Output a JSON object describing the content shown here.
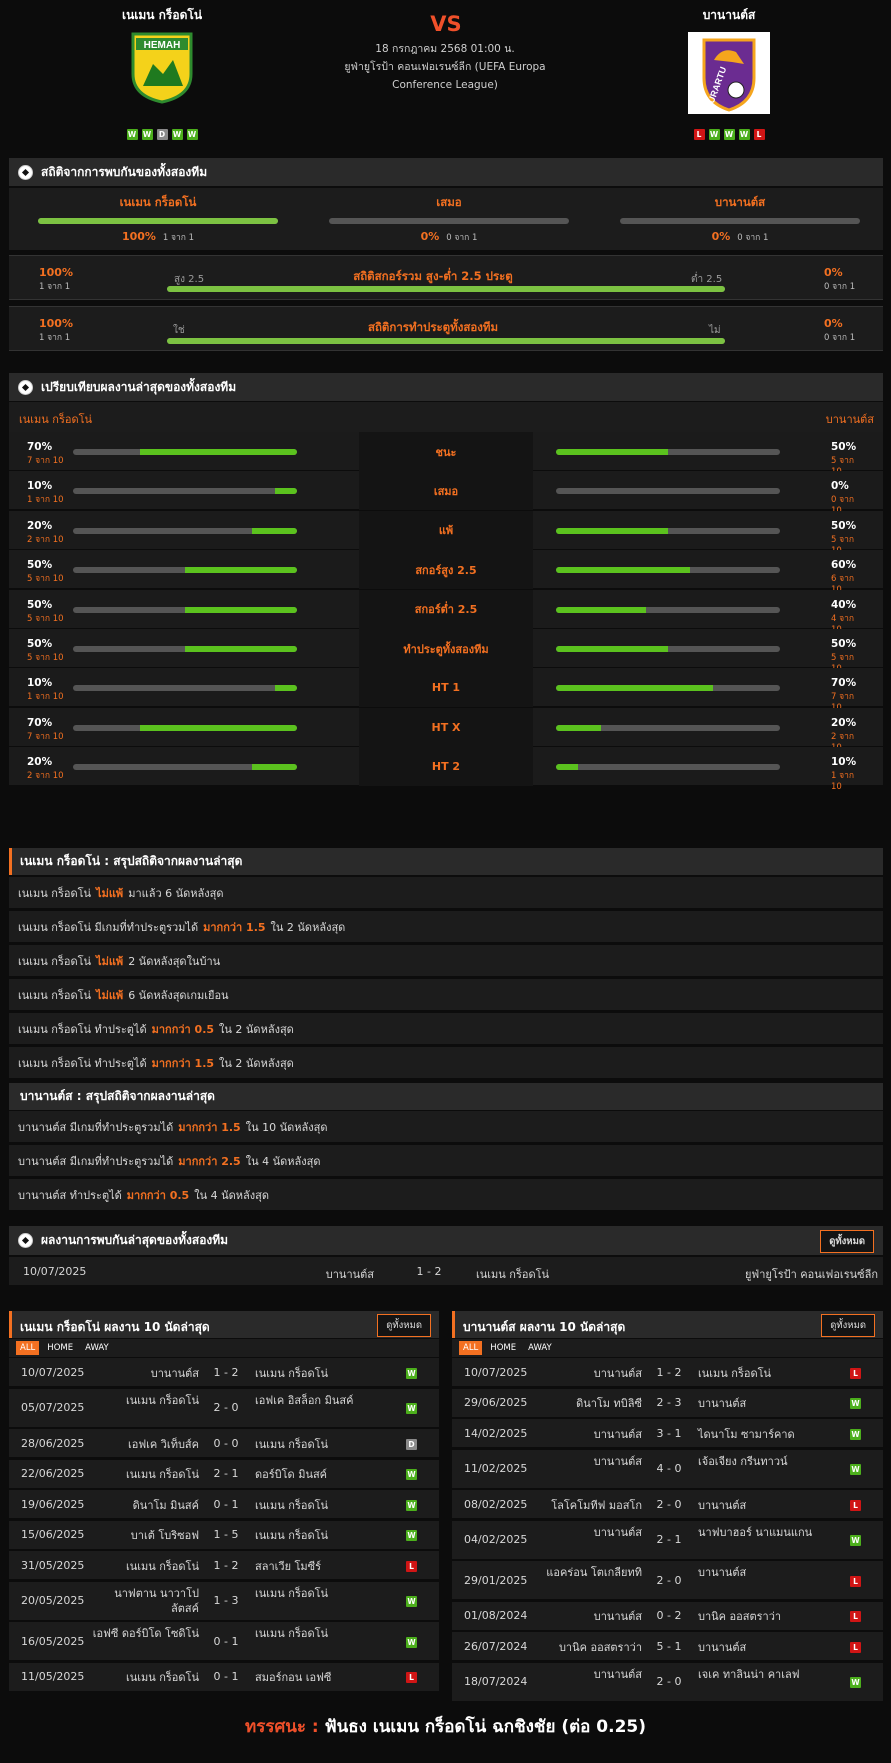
{
  "header": {
    "home_name": "เนเมน กร็อดโน่",
    "away_name": "บานานต์ส",
    "vs": "VS",
    "match_date": "18 กรกฎาคม 2568 01:00 น.",
    "competition_line1": "ยูฟ่ายูโรป้า คอนเฟอเรนซ์ลีก (UEFA Europa",
    "competition_line2": "Conference League)",
    "home_form": [
      "W",
      "W",
      "D",
      "W",
      "W"
    ],
    "away_form": [
      "L",
      "W",
      "W",
      "W",
      "L"
    ],
    "home_logo_text": "НЕМАН",
    "away_logo_text": "URARTU"
  },
  "h2h_stats": {
    "title": "สถิติจากการพบกันของทั้งสองทีม",
    "home": {
      "label": "เนเมน กร็อดโน่",
      "pct": "100%",
      "count": "1 จาก 1",
      "value": 1.0
    },
    "draw": {
      "label": "เสมอ",
      "pct": "0%",
      "count": "0 จาก 1",
      "value": 0
    },
    "away": {
      "label": "บานานต์ส",
      "pct": "0%",
      "count": "0 จาก 1",
      "value": 0
    },
    "over_under": {
      "left_pct": "100%",
      "left_count": "1 จาก 1",
      "left_label": "สูง 2.5",
      "title": "สถิติสกอร์รวม สูง-ต่ำ 2.5 ประตู",
      "right_label": "ต่ำ 2.5",
      "right_pct": "0%",
      "right_count": "0 จาก 1",
      "value": 1.0
    },
    "btts": {
      "left_pct": "100%",
      "left_count": "1 จาก 1",
      "left_label": "ใช่",
      "title": "สถิติการทำประตูทั้งสองทีม",
      "right_label": "ไม่",
      "right_pct": "0%",
      "right_count": "0 จาก 1",
      "value": 1.0
    }
  },
  "compare": {
    "title": "เปรียบเทียบผลงานล่าสุดของทั้งสองทีม",
    "home_label": "เนเมน กร็อดโน่",
    "away_label": "บานานต์ส",
    "rows": [
      {
        "label": "ชนะ",
        "lp": "70%",
        "lc": "7 จาก 10",
        "lv": 0.7,
        "rp": "50%",
        "rc": "5 จาก 10",
        "rv": 0.5
      },
      {
        "label": "เสมอ",
        "lp": "10%",
        "lc": "1 จาก 10",
        "lv": 0.1,
        "rp": "0%",
        "rc": "0 จาก 10",
        "rv": 0
      },
      {
        "label": "แพ้",
        "lp": "20%",
        "lc": "2 จาก 10",
        "lv": 0.2,
        "rp": "50%",
        "rc": "5 จาก 10",
        "rv": 0.5
      },
      {
        "label": "สกอร์สูง 2.5",
        "lp": "50%",
        "lc": "5 จาก 10",
        "lv": 0.5,
        "rp": "60%",
        "rc": "6 จาก 10",
        "rv": 0.6
      },
      {
        "label": "สกอร์ต่ำ 2.5",
        "lp": "50%",
        "lc": "5 จาก 10",
        "lv": 0.5,
        "rp": "40%",
        "rc": "4 จาก 10",
        "rv": 0.4
      },
      {
        "label": "ทำประตูทั้งสองทีม",
        "lp": "50%",
        "lc": "5 จาก 10",
        "lv": 0.5,
        "rp": "50%",
        "rc": "5 จาก 10",
        "rv": 0.5
      },
      {
        "label": "HT 1",
        "lp": "10%",
        "lc": "1 จาก 10",
        "lv": 0.1,
        "rp": "70%",
        "rc": "7 จาก 10",
        "rv": 0.7
      },
      {
        "label": "HT X",
        "lp": "70%",
        "lc": "7 จาก 10",
        "lv": 0.7,
        "rp": "20%",
        "rc": "2 จาก 10",
        "rv": 0.2
      },
      {
        "label": "HT 2",
        "lp": "20%",
        "lc": "2 จาก 10",
        "lv": 0.2,
        "rp": "10%",
        "rc": "1 จาก 10",
        "rv": 0.1
      }
    ]
  },
  "home_summary": {
    "title": "เนเมน กร็อดโน่ : สรุปสถิติจากผลงานล่าสุด",
    "rows": [
      {
        "pre": "เนเมน กร็อดโน่",
        "hl": "ไม่แพ้",
        "post": "มาแล้ว 6 นัดหลังสุด"
      },
      {
        "pre": "เนเมน กร็อดโน่ มีเกมที่ทำประตูรวมได้",
        "hl": "มากกว่า 1.5",
        "post": "ใน 2 นัดหลังสุด"
      },
      {
        "pre": "เนเมน กร็อดโน่",
        "hl": "ไม่แพ้",
        "post": "2 นัดหลังสุดในบ้าน"
      },
      {
        "pre": "เนเมน กร็อดโน่",
        "hl": "ไม่แพ้",
        "post": "6 นัดหลังสุดเกมเยือน"
      },
      {
        "pre": "เนเมน กร็อดโน่ ทำประตูได้",
        "hl": "มากกว่า 0.5",
        "post": "ใน 2 นัดหลังสุด"
      },
      {
        "pre": "เนเมน กร็อดโน่ ทำประตูได้",
        "hl": "มากกว่า 1.5",
        "post": "ใน 2 นัดหลังสุด"
      }
    ]
  },
  "away_summary": {
    "title": "บานานต์ส : สรุปสถิติจากผลงานล่าสุด",
    "rows": [
      {
        "pre": "บานานต์ส มีเกมที่ทำประตูรวมได้",
        "hl": "มากกว่า 1.5",
        "post": "ใน 10 นัดหลังสุด"
      },
      {
        "pre": "บานานต์ส มีเกมที่ทำประตูรวมได้",
        "hl": "มากกว่า 2.5",
        "post": "ใน 4 นัดหลังสุด"
      },
      {
        "pre": "บานานต์ส ทำประตูได้",
        "hl": "มากกว่า 0.5",
        "post": "ใน 4 นัดหลังสุด"
      }
    ]
  },
  "h2h_results": {
    "title": "ผลงานการพบกันล่าสุดของทั้งสองทีม",
    "view_all": "ดูทั้งหมด",
    "rows": [
      {
        "date": "10/07/2025",
        "home": "บานานต์ส",
        "score": "1 - 2",
        "away": "เนเมน กร็อดโน่",
        "comp": "ยูฟ่ายูโรป้า คอนเฟอเรนซ์ลีก"
      }
    ]
  },
  "home_last10": {
    "title": "เนเมน กร็อดโน่ ผลงาน 10 นัดล่าสุด",
    "view_all": "ดูทั้งหมด",
    "tabs": [
      "ALL",
      "HOME",
      "AWAY"
    ],
    "rows": [
      {
        "date": "10/07/2025",
        "home": "บานานต์ส",
        "score": "1 - 2",
        "away": "เนเมน กร็อดโน่",
        "res": "W"
      },
      {
        "date": "05/07/2025",
        "home": "เนเมน กร็อดโน่",
        "score": "2 - 0",
        "away": "เอฟเค อิสล็อก มินสค์",
        "res": "W"
      },
      {
        "date": "28/06/2025",
        "home": "เอฟเค วิเท็บส์ค",
        "score": "0 - 0",
        "away": "เนเมน กร็อดโน่",
        "res": "D"
      },
      {
        "date": "22/06/2025",
        "home": "เนเมน กร็อดโน่",
        "score": "2 - 1",
        "away": "ดอร์บิโด มินสค์",
        "res": "W"
      },
      {
        "date": "19/06/2025",
        "home": "ดินาโม มินสค์",
        "score": "0 - 1",
        "away": "เนเมน กร็อดโน่",
        "res": "W"
      },
      {
        "date": "15/06/2025",
        "home": "บาเต้ โบริซอฟ",
        "score": "1 - 5",
        "away": "เนเมน กร็อดโน่",
        "res": "W"
      },
      {
        "date": "31/05/2025",
        "home": "เนเมน กร็อดโน่",
        "score": "1 - 2",
        "away": "สลาเวีย โมซีร์",
        "res": "L"
      },
      {
        "date": "20/05/2025",
        "home": "นาฟตาน นาวาโปลัตสค์",
        "score": "1 - 3",
        "away": "เนเมน กร็อดโน่",
        "res": "W"
      },
      {
        "date": "16/05/2025",
        "home": "เอฟซี ดอร์บิโด โซดิโน่",
        "score": "0 - 1",
        "away": "เนเมน กร็อดโน่",
        "res": "W"
      },
      {
        "date": "11/05/2025",
        "home": "เนเมน กร็อดโน่",
        "score": "0 - 1",
        "away": "สมอร์กอน เอฟซี",
        "res": "L"
      }
    ]
  },
  "away_last10": {
    "title": "บานานต์ส ผลงาน 10 นัดล่าสุด",
    "view_all": "ดูทั้งหมด",
    "tabs": [
      "ALL",
      "HOME",
      "AWAY"
    ],
    "rows": [
      {
        "date": "10/07/2025",
        "home": "บานานต์ส",
        "score": "1 - 2",
        "away": "เนเมน กร็อดโน่",
        "res": "L"
      },
      {
        "date": "29/06/2025",
        "home": "ดินาโม ทบิลิซี",
        "score": "2 - 3",
        "away": "บานานต์ส",
        "res": "W"
      },
      {
        "date": "14/02/2025",
        "home": "บานานต์ส",
        "score": "3 - 1",
        "away": "ไดนาโม ซามาร์คาด",
        "res": "W"
      },
      {
        "date": "11/02/2025",
        "home": "บานานต์ส",
        "score": "4 - 0",
        "away": "เจ้อเจียง กรีนทาวน์",
        "res": "W"
      },
      {
        "date": "08/02/2025",
        "home": "โลโคโมทีฟ มอสโก",
        "score": "2 - 0",
        "away": "บานานต์ส",
        "res": "L"
      },
      {
        "date": "04/02/2025",
        "home": "บานานต์ส",
        "score": "2 - 1",
        "away": "นาฟบาฮอร์ นาแมนแกน",
        "res": "W"
      },
      {
        "date": "29/01/2025",
        "home": "แอคร่อน โตเกลียททิ",
        "score": "2 - 0",
        "away": "บานานต์ส",
        "res": "L"
      },
      {
        "date": "01/08/2024",
        "home": "บานานต์ส",
        "score": "0 - 2",
        "away": "บานิค ออสตราว่า",
        "res": "L"
      },
      {
        "date": "26/07/2024",
        "home": "บานิค ออสตราว่า",
        "score": "5 - 1",
        "away": "บานานต์ส",
        "res": "L"
      },
      {
        "date": "18/07/2024",
        "home": "บานานต์ส",
        "score": "2 - 0",
        "away": "เจเค ทาลินน่า คาเลฟ",
        "res": "W"
      }
    ]
  },
  "prediction": {
    "label": "ทรรศนะ :",
    "text": "ฟันธง เนเมน กร็อดโน่ ฉกชิงชัย (ต่อ 0.25)"
  },
  "colors": {
    "accent": "#f37021",
    "bar": "#5bc21e",
    "win": "#4caf1c",
    "loss": "#d01515",
    "draw": "#8a8a8a"
  }
}
